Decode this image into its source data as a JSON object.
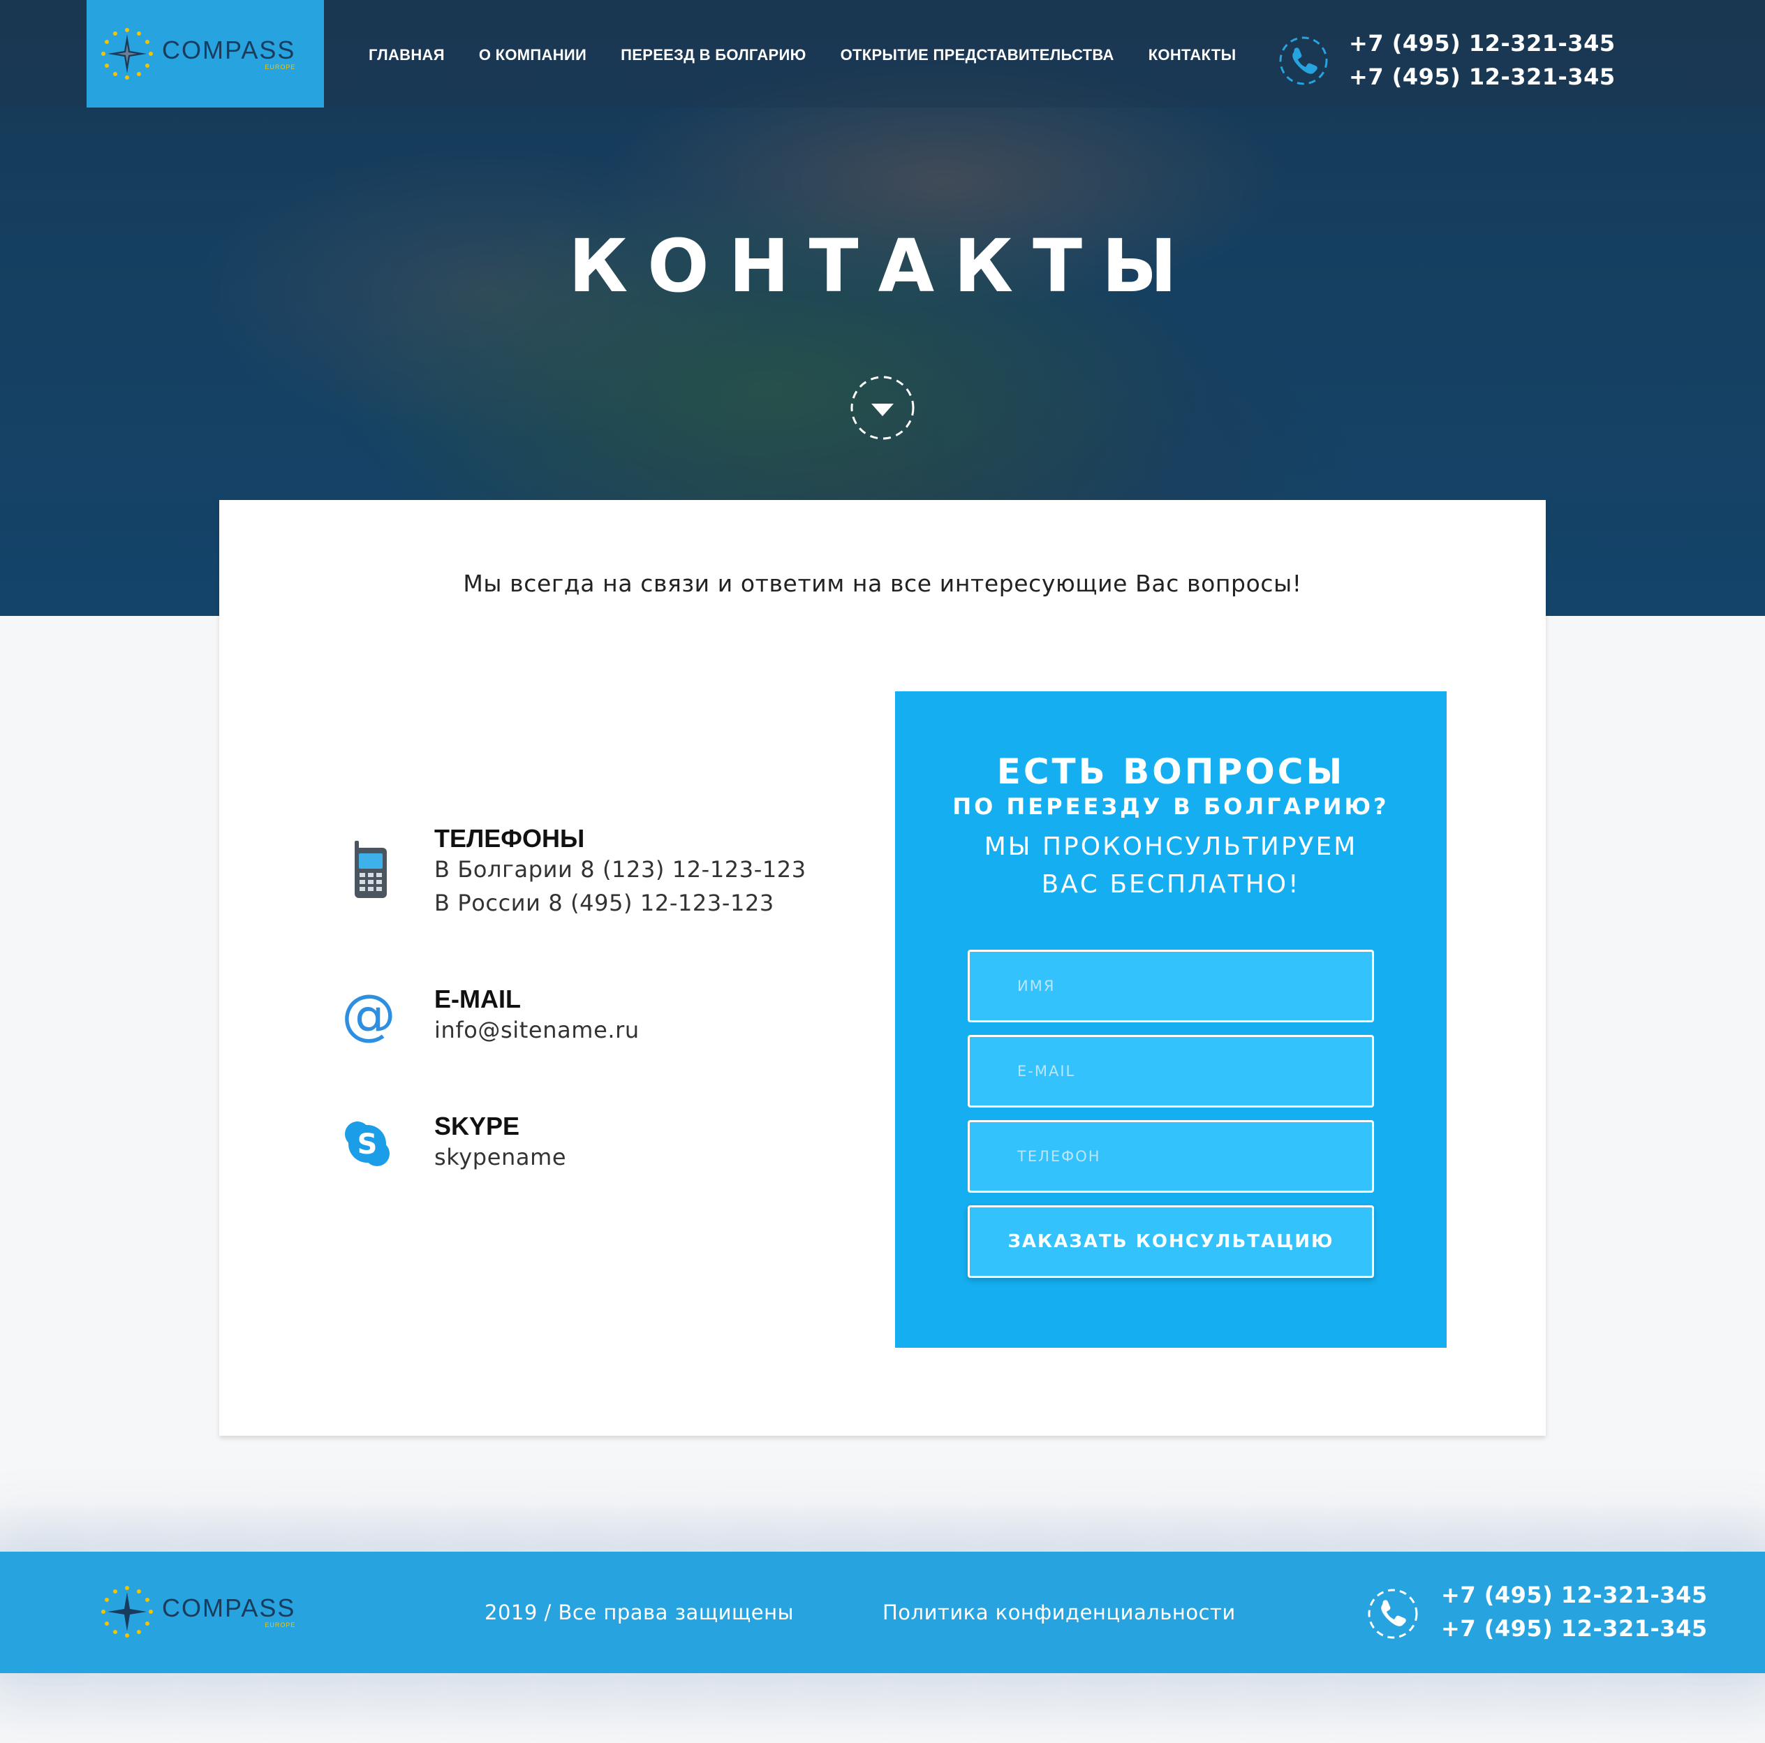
{
  "header": {
    "logo": {
      "name": "COMPASS",
      "sub": "EUROPE"
    },
    "nav": [
      {
        "label": "ГЛАВНАЯ"
      },
      {
        "label": "О КОМПАНИИ"
      },
      {
        "label": "ПЕРЕЕЗД В БОЛГАРИЮ"
      },
      {
        "label": "ОТКРЫТИЕ ПРЕДСТАВИТЕЛЬСТВА"
      },
      {
        "label": "КОНТАКТЫ"
      }
    ],
    "phones": [
      "+7 (495) 12-321-345",
      "+7 (495) 12-321-345"
    ]
  },
  "hero": {
    "title": "КОНТАКТЫ"
  },
  "content": {
    "intro": "Мы всегда на связи и ответим на все интересующие Вас вопросы!",
    "contacts": [
      {
        "icon": "mobile-phone-icon",
        "title": "ТЕЛЕФОНЫ",
        "lines": [
          "В Болгарии 8 (123) 12-123-123",
          "В России 8 (495) 12-123-123"
        ]
      },
      {
        "icon": "at-sign-icon",
        "title": "E-MAIL",
        "lines": [
          "info@sitename.ru"
        ]
      },
      {
        "icon": "skype-icon",
        "title": "SKYPE",
        "lines": [
          "skypename"
        ]
      }
    ]
  },
  "form": {
    "heading1": "ЕСТЬ ВОПРОСЫ",
    "heading2": "ПО ПЕРЕЕЗДУ В БОЛГАРИЮ?",
    "heading3_line1": "МЫ ПРОКОНСУЛЬТИРУЕМ",
    "heading3_line2": "ВАС БЕСПЛАТНО!",
    "name_placeholder": "ИМЯ",
    "email_placeholder": "E-MAIL",
    "phone_placeholder": "ТЕЛЕФОН",
    "submit_label": "ЗАКАЗАТЬ КОНСУЛЬТАЦИЮ"
  },
  "footer": {
    "logo": {
      "name": "COMPASS",
      "sub": "EUROPE"
    },
    "copyright": "2019 / Все права защищены",
    "privacy": "Политика конфиденциальности",
    "phones": [
      "+7 (495) 12-321-345",
      "+7 (495) 12-321-345"
    ]
  },
  "colors": {
    "accent": "#27a3e0",
    "form_bg": "#15aef0",
    "field_bg": "#33c2fb",
    "logo_text": "#1a3c5c",
    "logo_sub": "#f5c400"
  }
}
